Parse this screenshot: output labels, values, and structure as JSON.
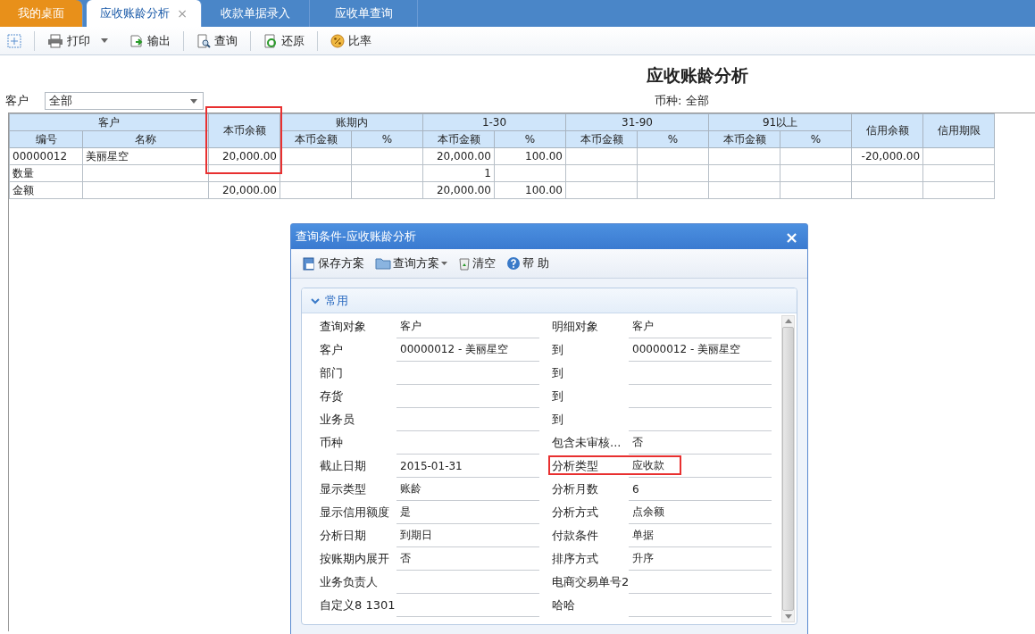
{
  "tabs": [
    {
      "label": "我的桌面",
      "kind": "home",
      "selected": false
    },
    {
      "label": "应收账龄分析",
      "kind": "page",
      "selected": true,
      "close": "×"
    },
    {
      "label": "收款单据录入",
      "kind": "page",
      "selected": false
    },
    {
      "label": "应收单查询",
      "kind": "page",
      "selected": false
    }
  ],
  "toolbar": [
    {
      "label": "打印",
      "dropdown": true
    },
    {
      "label": "输出",
      "dropdown": false
    },
    {
      "label": "查询",
      "dropdown": false
    },
    {
      "label": "还原",
      "dropdown": false
    },
    {
      "label": "比率",
      "dropdown": false
    }
  ],
  "report_title": "应收账龄分析",
  "filter": {
    "label": "客户",
    "value": "全部"
  },
  "currency": {
    "label": "币种:",
    "value": "全部"
  },
  "table": {
    "groups": [
      {
        "label": "客户",
        "subs": [
          "编号",
          "名称"
        ],
        "highlighted": false
      },
      {
        "label": "本币余额",
        "highlighted": true
      },
      {
        "label": "账期内",
        "subs": [
          "本币金额",
          "%"
        ],
        "highlighted": false
      },
      {
        "label": "1-30",
        "subs": [
          "本币金额",
          "%"
        ],
        "highlighted": false
      },
      {
        "label": "31-90",
        "subs": [
          "本币金额",
          "%"
        ],
        "highlighted": false
      },
      {
        "label": "91以上",
        "subs": [
          "本币金额",
          "%"
        ],
        "highlighted": false
      },
      {
        "label": "信用余额",
        "highlighted": false
      },
      {
        "label": "信用期限",
        "highlighted": false
      }
    ],
    "rows": [
      {
        "code": "00000012",
        "name": "美丽星空",
        "balance": "20,000.00",
        "b1_amt": "20,000.00",
        "b1_pct": "100.00",
        "credit_balance": "-20,000.00"
      },
      {
        "code": "数量",
        "b1_amt": "1"
      },
      {
        "code": "金额",
        "balance": "20,000.00",
        "b1_amt": "20,000.00",
        "b1_pct": "100.00"
      }
    ]
  },
  "dialog": {
    "title": "查询条件-应收账龄分析",
    "close": "×",
    "toolbar": [
      {
        "label": "保存方案",
        "dropdown": false
      },
      {
        "label": "查询方案",
        "dropdown": true
      },
      {
        "label": "清空",
        "dropdown": false
      },
      {
        "label": "帮 助",
        "dropdown": false
      }
    ],
    "section": {
      "label": "常用",
      "expanded": true
    },
    "rows": [
      [
        {
          "label": "查询对象",
          "value": "客户"
        },
        {
          "label": "明细对象",
          "value": "客户"
        }
      ],
      [
        {
          "label": "客户",
          "value": "00000012 - 美丽星空"
        },
        {
          "label": "到",
          "value": "00000012 - 美丽星空"
        }
      ],
      [
        {
          "label": "部门"
        },
        {
          "label": "到"
        }
      ],
      [
        {
          "label": "存货"
        },
        {
          "label": "到"
        }
      ],
      [
        {
          "label": "业务员"
        },
        {
          "label": "到"
        }
      ],
      [
        {
          "label": "币种"
        },
        {
          "label": "包含未审核...",
          "value": "否"
        }
      ],
      [
        {
          "label": "截止日期",
          "value": "2015-01-31"
        },
        {
          "label": "分析类型",
          "value": "应收款",
          "highlighted": true
        }
      ],
      [
        {
          "label": "显示类型",
          "value": "账龄"
        },
        {
          "label": "分析月数",
          "value": "6"
        }
      ],
      [
        {
          "label": "显示信用额度",
          "value": "是"
        },
        {
          "label": "分析方式",
          "value": "点余额"
        }
      ],
      [
        {
          "label": "分析日期",
          "value": "到期日"
        },
        {
          "label": "付款条件",
          "value": "单据"
        }
      ],
      [
        {
          "label": "按账期内展开",
          "value": "否"
        },
        {
          "label": "排序方式",
          "value": "升序"
        }
      ],
      [
        {
          "label": "业务负责人"
        },
        {
          "label": "电商交易单号2"
        }
      ],
      [
        {
          "label": "自定义8 1301"
        },
        {
          "label": "哈哈"
        }
      ]
    ]
  }
}
